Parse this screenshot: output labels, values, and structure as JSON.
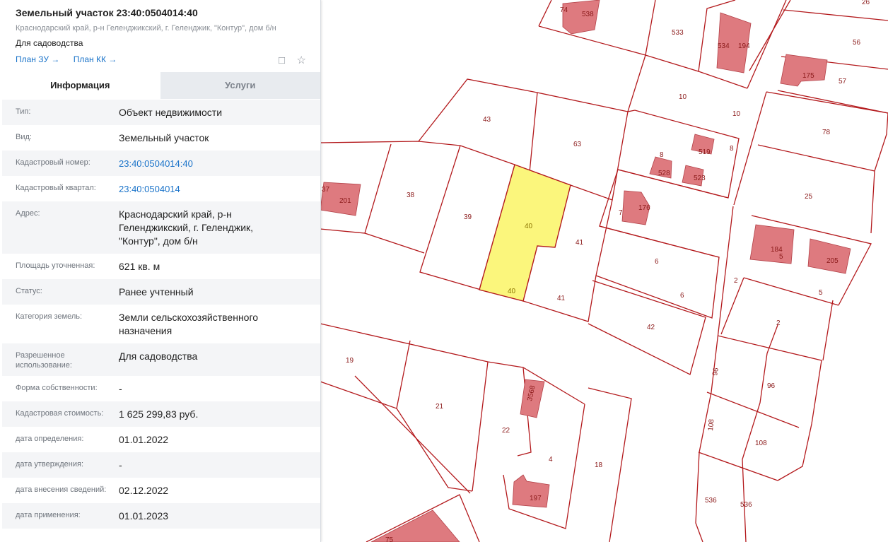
{
  "parcel": {
    "title": "Земельный участок 23:40:0504014:40",
    "address": "Краснодарский край, р-н Геленджикский, г. Геленджик, \"Контур\", дом б/н",
    "use": "Для садоводства",
    "links": [
      "План ЗУ →",
      "План КК →"
    ]
  },
  "tabs": [
    "Информация",
    "Услуги"
  ],
  "rows": [
    {
      "label": "Тип:",
      "value": "Объект недвижимости"
    },
    {
      "label": "Вид:",
      "value": "Земельный участок"
    },
    {
      "label": "Кадастровый номер:",
      "value": "23:40:0504014:40",
      "link": true
    },
    {
      "label": "Кадастровый квартал:",
      "value": "23:40:0504014",
      "link": true
    },
    {
      "label": "Адрес:",
      "value": "Краснодарский край, р-н Геленджикский, г. Геленджик, \"Контур\", дом б/н"
    },
    {
      "label": "Площадь уточненная:",
      "value": "621 кв. м"
    },
    {
      "label": "Статус:",
      "value": "Ранее учтенный"
    },
    {
      "label": "Категория земель:",
      "value": "Земли сельскохозяйственного назначения"
    },
    {
      "label": "Разрешенное использование:",
      "value": "Для садоводства"
    },
    {
      "label": "Форма собственности:",
      "value": "-"
    },
    {
      "label": "Кадастровая стоимость:",
      "value": "1 625 299,83 руб."
    },
    {
      "label": "дата определения:",
      "value": "01.01.2022"
    },
    {
      "label": "дата утверждения:",
      "value": "-"
    },
    {
      "label": "дата внесения сведений:",
      "value": "02.12.2022"
    },
    {
      "label": "дата применения:",
      "value": "01.01.2023"
    }
  ],
  "map": {
    "colors": {
      "boundary": "#b3191c",
      "building": "#de7a7f",
      "selected": "#fbf67c",
      "label": "#8b1a1a"
    },
    "parcel_labels": [
      "74",
      "538",
      "26",
      "533",
      "534",
      "194",
      "56",
      "175",
      "57",
      "43",
      "10",
      "10",
      "63",
      "78",
      "8",
      "519",
      "528",
      "523",
      "8",
      "37",
      "201",
      "38",
      "39",
      "40",
      "40",
      "41",
      "41",
      "7",
      "176",
      "25",
      "184",
      "5",
      "205",
      "6",
      "6",
      "2",
      "5",
      "2",
      "42",
      "19",
      "21",
      "22",
      "3568",
      "96",
      "96",
      "4",
      "18",
      "108",
      "108",
      "197",
      "536",
      "536",
      "75"
    ]
  }
}
